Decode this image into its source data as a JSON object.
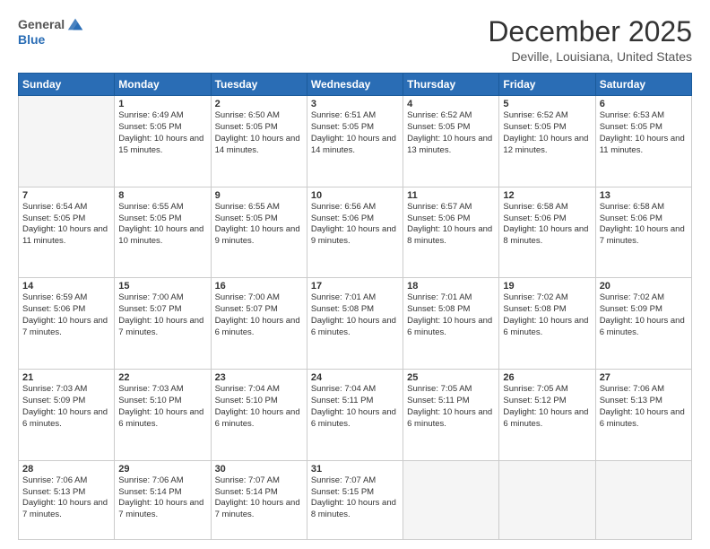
{
  "header": {
    "logo": {
      "general": "General",
      "blue": "Blue"
    },
    "title": "December 2025",
    "subtitle": "Deville, Louisiana, United States"
  },
  "calendar": {
    "days_header": [
      "Sunday",
      "Monday",
      "Tuesday",
      "Wednesday",
      "Thursday",
      "Friday",
      "Saturday"
    ],
    "weeks": [
      [
        {
          "day": "",
          "empty": true
        },
        {
          "day": "1",
          "sunrise": "Sunrise: 6:49 AM",
          "sunset": "Sunset: 5:05 PM",
          "daylight": "Daylight: 10 hours and 15 minutes."
        },
        {
          "day": "2",
          "sunrise": "Sunrise: 6:50 AM",
          "sunset": "Sunset: 5:05 PM",
          "daylight": "Daylight: 10 hours and 14 minutes."
        },
        {
          "day": "3",
          "sunrise": "Sunrise: 6:51 AM",
          "sunset": "Sunset: 5:05 PM",
          "daylight": "Daylight: 10 hours and 14 minutes."
        },
        {
          "day": "4",
          "sunrise": "Sunrise: 6:52 AM",
          "sunset": "Sunset: 5:05 PM",
          "daylight": "Daylight: 10 hours and 13 minutes."
        },
        {
          "day": "5",
          "sunrise": "Sunrise: 6:52 AM",
          "sunset": "Sunset: 5:05 PM",
          "daylight": "Daylight: 10 hours and 12 minutes."
        },
        {
          "day": "6",
          "sunrise": "Sunrise: 6:53 AM",
          "sunset": "Sunset: 5:05 PM",
          "daylight": "Daylight: 10 hours and 11 minutes."
        }
      ],
      [
        {
          "day": "7",
          "sunrise": "Sunrise: 6:54 AM",
          "sunset": "Sunset: 5:05 PM",
          "daylight": "Daylight: 10 hours and 11 minutes."
        },
        {
          "day": "8",
          "sunrise": "Sunrise: 6:55 AM",
          "sunset": "Sunset: 5:05 PM",
          "daylight": "Daylight: 10 hours and 10 minutes."
        },
        {
          "day": "9",
          "sunrise": "Sunrise: 6:55 AM",
          "sunset": "Sunset: 5:05 PM",
          "daylight": "Daylight: 10 hours and 9 minutes."
        },
        {
          "day": "10",
          "sunrise": "Sunrise: 6:56 AM",
          "sunset": "Sunset: 5:06 PM",
          "daylight": "Daylight: 10 hours and 9 minutes."
        },
        {
          "day": "11",
          "sunrise": "Sunrise: 6:57 AM",
          "sunset": "Sunset: 5:06 PM",
          "daylight": "Daylight: 10 hours and 8 minutes."
        },
        {
          "day": "12",
          "sunrise": "Sunrise: 6:58 AM",
          "sunset": "Sunset: 5:06 PM",
          "daylight": "Daylight: 10 hours and 8 minutes."
        },
        {
          "day": "13",
          "sunrise": "Sunrise: 6:58 AM",
          "sunset": "Sunset: 5:06 PM",
          "daylight": "Daylight: 10 hours and 7 minutes."
        }
      ],
      [
        {
          "day": "14",
          "sunrise": "Sunrise: 6:59 AM",
          "sunset": "Sunset: 5:06 PM",
          "daylight": "Daylight: 10 hours and 7 minutes."
        },
        {
          "day": "15",
          "sunrise": "Sunrise: 7:00 AM",
          "sunset": "Sunset: 5:07 PM",
          "daylight": "Daylight: 10 hours and 7 minutes."
        },
        {
          "day": "16",
          "sunrise": "Sunrise: 7:00 AM",
          "sunset": "Sunset: 5:07 PM",
          "daylight": "Daylight: 10 hours and 6 minutes."
        },
        {
          "day": "17",
          "sunrise": "Sunrise: 7:01 AM",
          "sunset": "Sunset: 5:08 PM",
          "daylight": "Daylight: 10 hours and 6 minutes."
        },
        {
          "day": "18",
          "sunrise": "Sunrise: 7:01 AM",
          "sunset": "Sunset: 5:08 PM",
          "daylight": "Daylight: 10 hours and 6 minutes."
        },
        {
          "day": "19",
          "sunrise": "Sunrise: 7:02 AM",
          "sunset": "Sunset: 5:08 PM",
          "daylight": "Daylight: 10 hours and 6 minutes."
        },
        {
          "day": "20",
          "sunrise": "Sunrise: 7:02 AM",
          "sunset": "Sunset: 5:09 PM",
          "daylight": "Daylight: 10 hours and 6 minutes."
        }
      ],
      [
        {
          "day": "21",
          "sunrise": "Sunrise: 7:03 AM",
          "sunset": "Sunset: 5:09 PM",
          "daylight": "Daylight: 10 hours and 6 minutes."
        },
        {
          "day": "22",
          "sunrise": "Sunrise: 7:03 AM",
          "sunset": "Sunset: 5:10 PM",
          "daylight": "Daylight: 10 hours and 6 minutes."
        },
        {
          "day": "23",
          "sunrise": "Sunrise: 7:04 AM",
          "sunset": "Sunset: 5:10 PM",
          "daylight": "Daylight: 10 hours and 6 minutes."
        },
        {
          "day": "24",
          "sunrise": "Sunrise: 7:04 AM",
          "sunset": "Sunset: 5:11 PM",
          "daylight": "Daylight: 10 hours and 6 minutes."
        },
        {
          "day": "25",
          "sunrise": "Sunrise: 7:05 AM",
          "sunset": "Sunset: 5:11 PM",
          "daylight": "Daylight: 10 hours and 6 minutes."
        },
        {
          "day": "26",
          "sunrise": "Sunrise: 7:05 AM",
          "sunset": "Sunset: 5:12 PM",
          "daylight": "Daylight: 10 hours and 6 minutes."
        },
        {
          "day": "27",
          "sunrise": "Sunrise: 7:06 AM",
          "sunset": "Sunset: 5:13 PM",
          "daylight": "Daylight: 10 hours and 6 minutes."
        }
      ],
      [
        {
          "day": "28",
          "sunrise": "Sunrise: 7:06 AM",
          "sunset": "Sunset: 5:13 PM",
          "daylight": "Daylight: 10 hours and 7 minutes."
        },
        {
          "day": "29",
          "sunrise": "Sunrise: 7:06 AM",
          "sunset": "Sunset: 5:14 PM",
          "daylight": "Daylight: 10 hours and 7 minutes."
        },
        {
          "day": "30",
          "sunrise": "Sunrise: 7:07 AM",
          "sunset": "Sunset: 5:14 PM",
          "daylight": "Daylight: 10 hours and 7 minutes."
        },
        {
          "day": "31",
          "sunrise": "Sunrise: 7:07 AM",
          "sunset": "Sunset: 5:15 PM",
          "daylight": "Daylight: 10 hours and 8 minutes."
        },
        {
          "day": "",
          "empty": true
        },
        {
          "day": "",
          "empty": true
        },
        {
          "day": "",
          "empty": true
        }
      ]
    ]
  }
}
